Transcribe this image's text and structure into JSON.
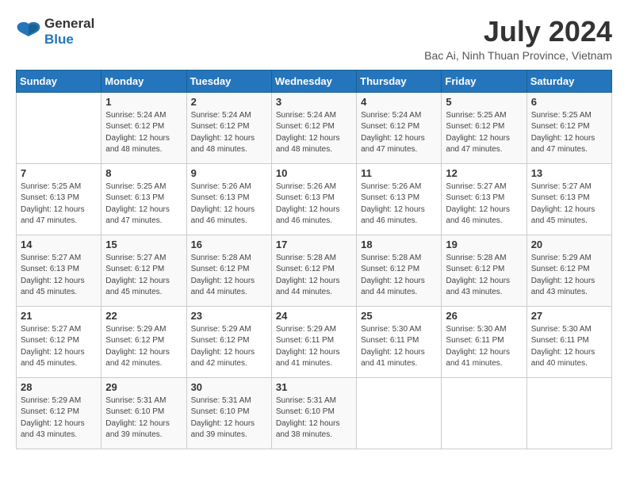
{
  "header": {
    "logo_line1": "General",
    "logo_line2": "Blue",
    "month_year": "July 2024",
    "location": "Bac Ai, Ninh Thuan Province, Vietnam"
  },
  "days_of_week": [
    "Sunday",
    "Monday",
    "Tuesday",
    "Wednesday",
    "Thursday",
    "Friday",
    "Saturday"
  ],
  "weeks": [
    [
      {
        "day": "",
        "info": ""
      },
      {
        "day": "1",
        "info": "Sunrise: 5:24 AM\nSunset: 6:12 PM\nDaylight: 12 hours\nand 48 minutes."
      },
      {
        "day": "2",
        "info": "Sunrise: 5:24 AM\nSunset: 6:12 PM\nDaylight: 12 hours\nand 48 minutes."
      },
      {
        "day": "3",
        "info": "Sunrise: 5:24 AM\nSunset: 6:12 PM\nDaylight: 12 hours\nand 48 minutes."
      },
      {
        "day": "4",
        "info": "Sunrise: 5:24 AM\nSunset: 6:12 PM\nDaylight: 12 hours\nand 47 minutes."
      },
      {
        "day": "5",
        "info": "Sunrise: 5:25 AM\nSunset: 6:12 PM\nDaylight: 12 hours\nand 47 minutes."
      },
      {
        "day": "6",
        "info": "Sunrise: 5:25 AM\nSunset: 6:12 PM\nDaylight: 12 hours\nand 47 minutes."
      }
    ],
    [
      {
        "day": "7",
        "info": ""
      },
      {
        "day": "8",
        "info": "Sunrise: 5:25 AM\nSunset: 6:13 PM\nDaylight: 12 hours\nand 47 minutes."
      },
      {
        "day": "9",
        "info": "Sunrise: 5:26 AM\nSunset: 6:13 PM\nDaylight: 12 hours\nand 46 minutes."
      },
      {
        "day": "10",
        "info": "Sunrise: 5:26 AM\nSunset: 6:13 PM\nDaylight: 12 hours\nand 46 minutes."
      },
      {
        "day": "11",
        "info": "Sunrise: 5:26 AM\nSunset: 6:13 PM\nDaylight: 12 hours\nand 46 minutes."
      },
      {
        "day": "12",
        "info": "Sunrise: 5:27 AM\nSunset: 6:13 PM\nDaylight: 12 hours\nand 46 minutes."
      },
      {
        "day": "13",
        "info": "Sunrise: 5:27 AM\nSunset: 6:13 PM\nDaylight: 12 hours\nand 45 minutes."
      }
    ],
    [
      {
        "day": "14",
        "info": ""
      },
      {
        "day": "15",
        "info": "Sunrise: 5:27 AM\nSunset: 6:12 PM\nDaylight: 12 hours\nand 45 minutes."
      },
      {
        "day": "16",
        "info": "Sunrise: 5:28 AM\nSunset: 6:12 PM\nDaylight: 12 hours\nand 44 minutes."
      },
      {
        "day": "17",
        "info": "Sunrise: 5:28 AM\nSunset: 6:12 PM\nDaylight: 12 hours\nand 44 minutes."
      },
      {
        "day": "18",
        "info": "Sunrise: 5:28 AM\nSunset: 6:12 PM\nDaylight: 12 hours\nand 44 minutes."
      },
      {
        "day": "19",
        "info": "Sunrise: 5:28 AM\nSunset: 6:12 PM\nDaylight: 12 hours\nand 43 minutes."
      },
      {
        "day": "20",
        "info": "Sunrise: 5:29 AM\nSunset: 6:12 PM\nDaylight: 12 hours\nand 43 minutes."
      }
    ],
    [
      {
        "day": "21",
        "info": ""
      },
      {
        "day": "22",
        "info": "Sunrise: 5:29 AM\nSunset: 6:12 PM\nDaylight: 12 hours\nand 42 minutes."
      },
      {
        "day": "23",
        "info": "Sunrise: 5:29 AM\nSunset: 6:12 PM\nDaylight: 12 hours\nand 42 minutes."
      },
      {
        "day": "24",
        "info": "Sunrise: 5:29 AM\nSunset: 6:11 PM\nDaylight: 12 hours\nand 41 minutes."
      },
      {
        "day": "25",
        "info": "Sunrise: 5:30 AM\nSunset: 6:11 PM\nDaylight: 12 hours\nand 41 minutes."
      },
      {
        "day": "26",
        "info": "Sunrise: 5:30 AM\nSunset: 6:11 PM\nDaylight: 12 hours\nand 41 minutes."
      },
      {
        "day": "27",
        "info": "Sunrise: 5:30 AM\nSunset: 6:11 PM\nDaylight: 12 hours\nand 40 minutes."
      }
    ],
    [
      {
        "day": "28",
        "info": "Sunrise: 5:30 AM\nSunset: 6:11 PM\nDaylight: 12 hours\nand 40 minutes."
      },
      {
        "day": "29",
        "info": "Sunrise: 5:31 AM\nSunset: 6:10 PM\nDaylight: 12 hours\nand 39 minutes."
      },
      {
        "day": "30",
        "info": "Sunrise: 5:31 AM\nSunset: 6:10 PM\nDaylight: 12 hours\nand 39 minutes."
      },
      {
        "day": "31",
        "info": "Sunrise: 5:31 AM\nSunset: 6:10 PM\nDaylight: 12 hours\nand 38 minutes."
      },
      {
        "day": "",
        "info": ""
      },
      {
        "day": "",
        "info": ""
      },
      {
        "day": "",
        "info": ""
      }
    ]
  ],
  "week7_sunday": {
    "info": "Sunrise: 5:25 AM\nSunset: 6:13 PM\nDaylight: 12 hours\nand 47 minutes."
  },
  "week3_sunday": {
    "info": "Sunrise: 5:27 AM\nSunset: 6:13 PM\nDaylight: 12 hours\nand 45 minutes."
  },
  "week4_sunday": {
    "info": "Sunrise: 5:27 AM\nSunset: 6:12 PM\nDaylight: 12 hours\nand 45 minutes."
  },
  "week5_sunday": {
    "info": "Sunrise: 5:29 AM\nSunset: 6:12 PM\nDaylight: 12 hours\nand 43 minutes."
  },
  "week6_sunday": {
    "info": "Sunrise: 5:29 AM\nSunset: 6:12 PM\nDaylight: 12 hours\nand 42 minutes."
  }
}
